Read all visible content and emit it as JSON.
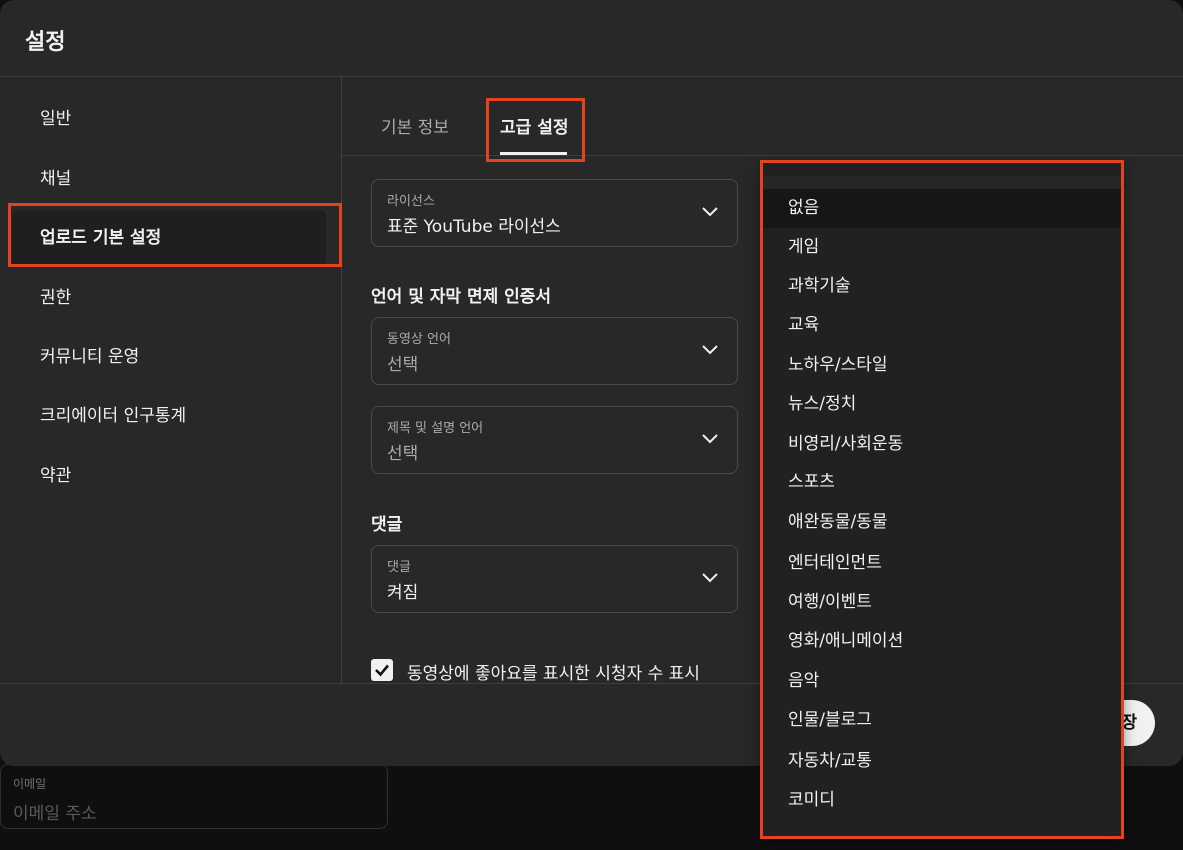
{
  "background": {
    "field_label": "이메일",
    "field_placeholder": "이메일 주소"
  },
  "dialog": {
    "title": "설정",
    "sidebar": {
      "items": [
        {
          "label": "일반"
        },
        {
          "label": "채널"
        },
        {
          "label": "업로드 기본 설정",
          "active": true
        },
        {
          "label": "권한"
        },
        {
          "label": "커뮤니티 운영"
        },
        {
          "label": "크리에이터 인구통계"
        },
        {
          "label": "약관"
        }
      ]
    },
    "tabs": [
      {
        "label": "기본 정보"
      },
      {
        "label": "고급 설정",
        "active": true
      }
    ],
    "license": {
      "label": "라이선스",
      "value": "표준 YouTube 라이선스"
    },
    "language_section": {
      "title": "언어 및 자막 면제 인증서",
      "video_language": {
        "label": "동영상 언어",
        "value": "선택"
      },
      "title_desc_language": {
        "label": "제목 및 설명 언어",
        "value": "선택"
      }
    },
    "comments_section": {
      "title": "댓글",
      "select": {
        "label": "댓글",
        "value": "켜짐"
      }
    },
    "likes_checkbox": {
      "label": "동영상에 좋아요를 표시한 시청자 수 표시",
      "checked": true
    },
    "save_label": "장"
  },
  "category_dropdown": {
    "items": [
      "없음",
      "게임",
      "과학기술",
      "교육",
      "노하우/스타일",
      "뉴스/정치",
      "비영리/사회운동",
      "스포츠",
      "애완동물/동물",
      "엔터테인먼트",
      "여행/이벤트",
      "영화/애니메이션",
      "음악",
      "인물/블로그",
      "자동차/교통",
      "코미디"
    ],
    "selected": "없음"
  },
  "colors": {
    "highlight": "#e5421f",
    "dialog_bg": "#282828",
    "page_bg": "#0f0f0f"
  }
}
